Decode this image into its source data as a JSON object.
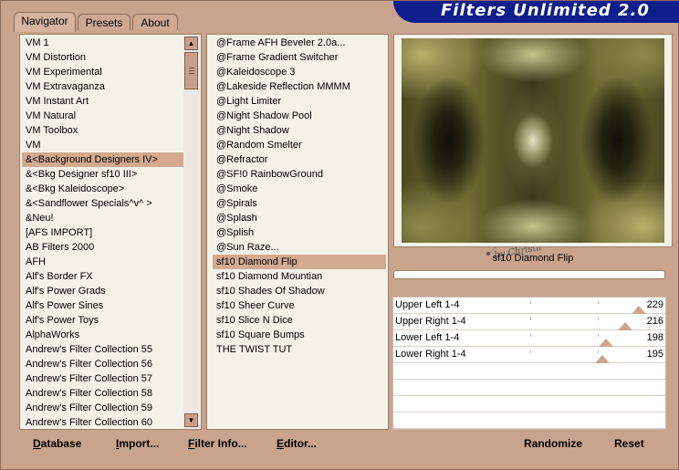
{
  "tabs": [
    {
      "label": "Navigator",
      "active": true
    },
    {
      "label": "Presets",
      "active": false
    },
    {
      "label": "About",
      "active": false
    }
  ],
  "logo_text": "Filters Unlimited 2.0",
  "categories": {
    "items": [
      "VM 1",
      "VM Distortion",
      "VM Experimental",
      "VM Extravaganza",
      "VM Instant Art",
      "VM Natural",
      "VM Toolbox",
      "VM",
      "&<Background Designers IV>",
      "&<Bkg Designer sf10 III>",
      "&<Bkg Kaleidoscope>",
      "&<Sandflower Specials^v^ >",
      "&Neu!",
      "[AFS IMPORT]",
      "AB Filters 2000",
      "AFH",
      "Alf's Border FX",
      "Alf's Power Grads",
      "Alf's Power Sines",
      "Alf's Power Toys",
      "AlphaWorks",
      "Andrew's Filter Collection 55",
      "Andrew's Filter Collection 56",
      "Andrew's Filter Collection 57",
      "Andrew's Filter Collection 58",
      "Andrew's Filter Collection 59",
      "Andrew's Filter Collection 60"
    ],
    "selected_index": 8
  },
  "filters": {
    "items": [
      "@Frame AFH Beveler 2.0a...",
      "@Frame Gradient Switcher",
      "@Kaleidoscope 3",
      "@Lakeside Reflection MMMM",
      "@Light Limiter",
      "@Night Shadow Pool",
      "@Night Shadow",
      "@Random Smelter",
      "@Refractor",
      "@SF!0 RainbowGround",
      "@Smoke",
      "@Spirals",
      "@Splash",
      "@Splish",
      "@Sun Raze...",
      "sf10 Diamond Flip",
      "sf10 Diamond Mountian",
      "sf10 Shades Of Shadow",
      "sf10 Sheer Curve",
      "sf10 Slice N Dice",
      "sf10 Square Bumps",
      "THE TWIST TUT"
    ],
    "selected_index": 15
  },
  "watermark_text": "by Christa",
  "preview": {
    "filter_name": "sf10 Diamond Flip"
  },
  "sliders": [
    {
      "label": "Upper Left 1-4",
      "value": 229
    },
    {
      "label": "Upper Right 1-4",
      "value": 216
    },
    {
      "label": "Lower Left 1-4",
      "value": 198
    },
    {
      "label": "Lower Right 1-4",
      "value": 195
    }
  ],
  "slider_max": 255,
  "buttons": {
    "database": {
      "mnemonic": "D",
      "rest": "atabase"
    },
    "import": {
      "mnemonic": "I",
      "rest": "mport..."
    },
    "filter_info": {
      "mnemonic": "F",
      "rest": "ilter Info..."
    },
    "editor": {
      "mnemonic": "E",
      "rest": "ditor..."
    },
    "randomize": "Randomize",
    "reset": "Reset"
  },
  "colors": {
    "window_bg": "#c9a38b",
    "logo_bg": "#0e1f8c",
    "selection": "#d3a98f"
  }
}
